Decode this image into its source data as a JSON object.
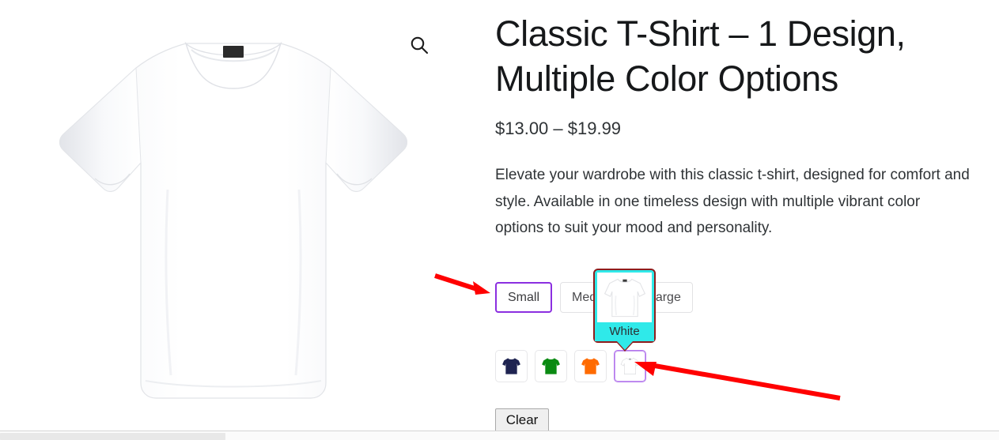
{
  "product": {
    "title": "Classic T-Shirt – 1 Design, Multiple Color Options",
    "price_range": "$13.00 – $19.99",
    "description": "Elevate your wardrobe with this classic t-shirt, designed for comfort and style. Available in one timeless design with multiple vibrant color options to suit your mood and personality.",
    "main_image_alt": "white-tshirt-front",
    "zoom_icon": "search-icon"
  },
  "options": {
    "size": {
      "values": [
        {
          "label": "Small",
          "selected": true
        },
        {
          "label": "Medium",
          "selected": false
        },
        {
          "label": "Large",
          "selected": false
        }
      ]
    },
    "color": {
      "values": [
        {
          "label": "Navy",
          "hex": "#1f2451",
          "selected": false
        },
        {
          "label": "Green",
          "hex": "#0a8a12",
          "selected": false
        },
        {
          "label": "Orange",
          "hex": "#ff6b00",
          "selected": false
        },
        {
          "label": "White",
          "hex": "#ffffff",
          "selected": true
        }
      ]
    },
    "clear_label": "Clear"
  },
  "tooltip": {
    "label": "White",
    "thumbnail_alt": "white-tshirt-thumbnail",
    "background": "#2fe9e9",
    "border": "#8f1d1d",
    "visible": true
  },
  "annotations": {
    "arrow_color": "#ff0000",
    "arrows": [
      {
        "name": "arrow-pointing-to-size-small",
        "direction": "right"
      },
      {
        "name": "arrow-pointing-to-white-color-swatch",
        "direction": "up-left"
      }
    ]
  },
  "theme": {
    "selected_border": "#8b2fe0",
    "swatch_border": "#e2e2e4",
    "text": "#2f3336"
  }
}
